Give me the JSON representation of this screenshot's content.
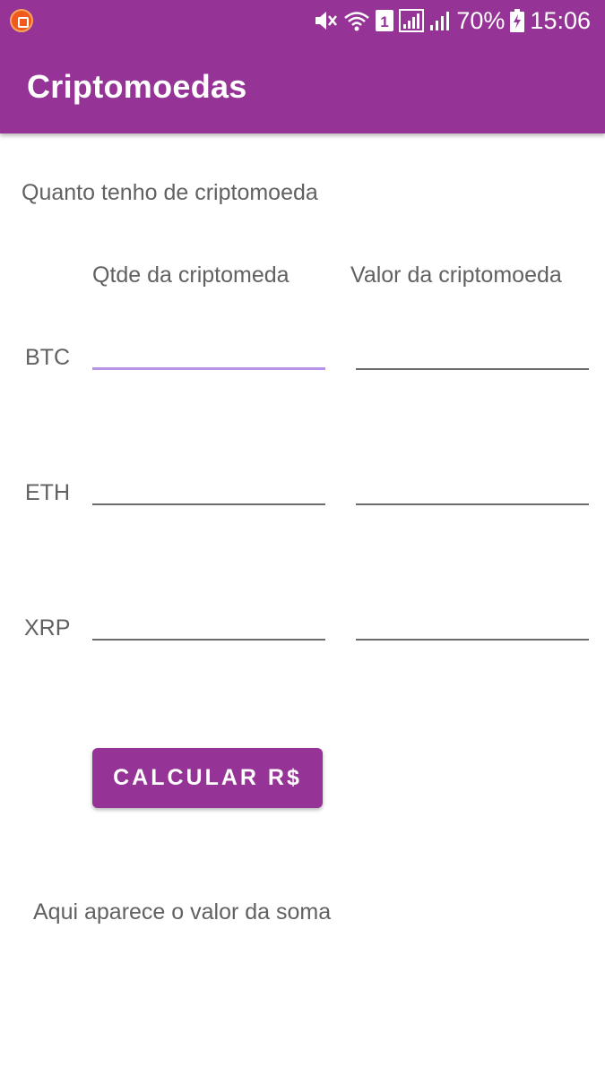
{
  "status_bar": {
    "battery": "70%",
    "time": "15:06",
    "sim_slot": "1"
  },
  "app_bar": {
    "title": "Criptomoedas"
  },
  "form": {
    "heading": "Quanto tenho de criptomoeda",
    "column_headers": [
      "Qtde da criptomeda",
      "Valor da criptomoeda"
    ],
    "rows": [
      {
        "label": "BTC",
        "qty_value": "",
        "price_value": ""
      },
      {
        "label": "ETH",
        "qty_value": "",
        "price_value": ""
      },
      {
        "label": "XRP",
        "qty_value": "",
        "price_value": ""
      }
    ],
    "focused_field": "btc-qty"
  },
  "actions": {
    "calculate_label": "CALCULAR R$"
  },
  "result": {
    "text": "Aqui aparece o valor da soma"
  },
  "colors": {
    "primary": "#953496",
    "focus_underline": "#b794e6",
    "text": "#616161"
  },
  "icons": [
    "app-notification-icon",
    "mute-icon",
    "wifi-icon",
    "sim-1-icon",
    "signal-icon",
    "signal-2-icon",
    "battery-charging-icon"
  ]
}
